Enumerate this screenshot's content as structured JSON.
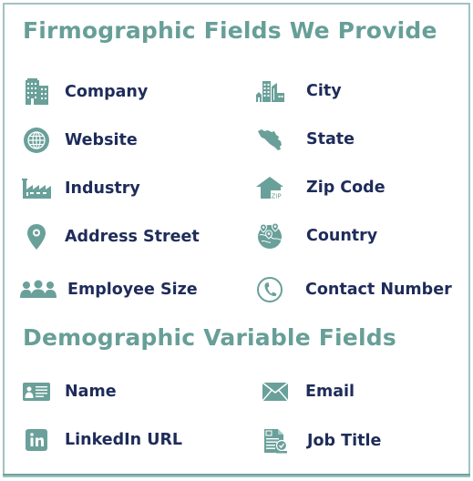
{
  "colors": {
    "accent": "#679f98",
    "icon": "#6aa09a",
    "label": "#1e2c5a",
    "border": "#9fc3bf"
  },
  "firmographic": {
    "title": "Firmographic Fields We Provide",
    "left": [
      {
        "label": "Company",
        "icon": "buildings-icon"
      },
      {
        "label": "Website",
        "icon": "globe-icon"
      },
      {
        "label": "Industry",
        "icon": "factory-icon"
      },
      {
        "label": "Address Street",
        "icon": "location-pin-icon"
      },
      {
        "label": "Employee Size",
        "icon": "people-group-icon"
      }
    ],
    "right": [
      {
        "label": "City",
        "icon": "city-skyline-icon"
      },
      {
        "label": "State",
        "icon": "state-map-icon"
      },
      {
        "label": "Zip Code",
        "icon": "zip-house-icon"
      },
      {
        "label": "Country",
        "icon": "globe-pins-icon"
      },
      {
        "label": "Contact Number",
        "icon": "phone-circle-icon"
      }
    ]
  },
  "demographic": {
    "title": "Demographic Variable Fields",
    "left": [
      {
        "label": "Name",
        "icon": "id-card-icon"
      },
      {
        "label": "LinkedIn URL",
        "icon": "linkedin-icon",
        "icon_text": "in"
      }
    ],
    "right": [
      {
        "label": "Email",
        "icon": "envelope-icon"
      },
      {
        "label": "Job Title",
        "icon": "job-document-icon"
      }
    ]
  }
}
